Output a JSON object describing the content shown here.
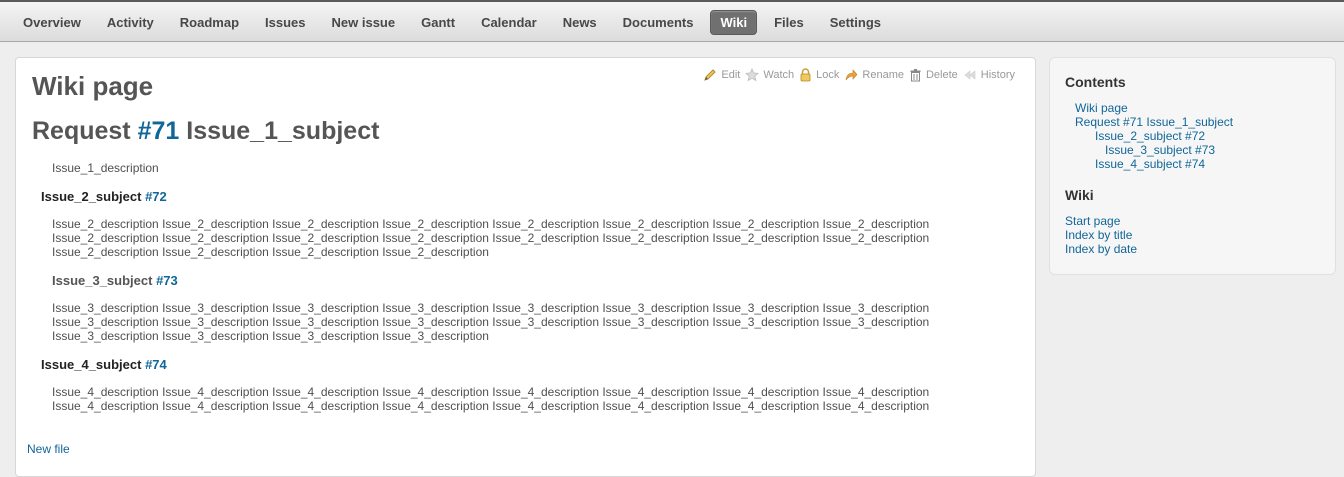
{
  "tabs": [
    "Overview",
    "Activity",
    "Roadmap",
    "Issues",
    "New issue",
    "Gantt",
    "Calendar",
    "News",
    "Documents",
    "Wiki",
    "Files",
    "Settings"
  ],
  "selected_tab": "Wiki",
  "contextual": {
    "edit": "Edit",
    "watch": "Watch",
    "lock": "Lock",
    "rename": "Rename",
    "delete": "Delete",
    "history": "History"
  },
  "page_title": "Wiki page",
  "h1": {
    "prefix": "Request ",
    "issue": "#71",
    "subject": " Issue_1_subject"
  },
  "issue1_desc": "Issue_1_description",
  "issue2": {
    "subject": "Issue_2_subject ",
    "num": "#72",
    "lines": [
      "Issue_2_description Issue_2_description Issue_2_description Issue_2_description Issue_2_description Issue_2_description Issue_2_description Issue_2_description",
      "Issue_2_description Issue_2_description Issue_2_description Issue_2_description Issue_2_description Issue_2_description Issue_2_description Issue_2_description",
      "Issue_2_description Issue_2_description Issue_2_description Issue_2_description"
    ]
  },
  "issue3": {
    "subject": "Issue_3_subject ",
    "num": "#73",
    "lines": [
      "Issue_3_description Issue_3_description Issue_3_description Issue_3_description Issue_3_description Issue_3_description Issue_3_description Issue_3_description",
      "Issue_3_description Issue_3_description Issue_3_description Issue_3_description Issue_3_description Issue_3_description Issue_3_description Issue_3_description",
      "Issue_3_description Issue_3_description Issue_3_description Issue_3_description"
    ]
  },
  "issue4": {
    "subject": "Issue_4_subject ",
    "num": "#74",
    "lines": [
      "Issue_4_description Issue_4_description Issue_4_description Issue_4_description Issue_4_description Issue_4_description Issue_4_description Issue_4_description",
      "Issue_4_description Issue_4_description Issue_4_description Issue_4_description Issue_4_description Issue_4_description Issue_4_description Issue_4_description"
    ]
  },
  "new_file": "New file",
  "sidebar": {
    "contents_title": "Contents",
    "toc": [
      "Wiki page",
      "Request #71 Issue_1_subject",
      "Issue_2_subject #72",
      "Issue_3_subject #73",
      "Issue_4_subject #74"
    ],
    "wiki_title": "Wiki",
    "wiki_links": [
      "Start page",
      "Index by title",
      "Index by date"
    ]
  }
}
